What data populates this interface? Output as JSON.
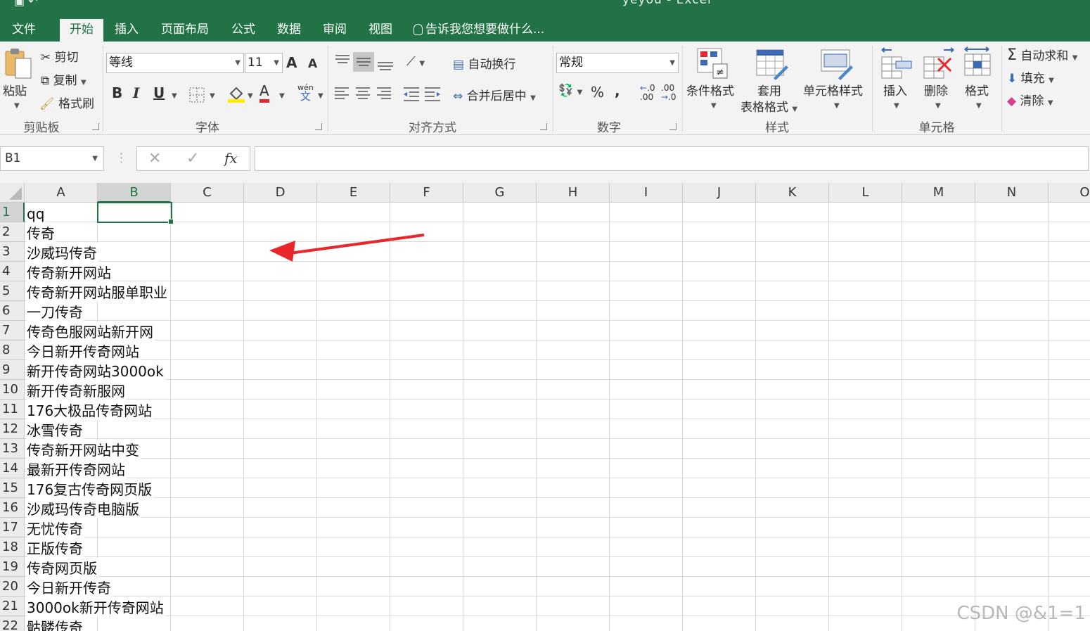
{
  "window": {
    "title": "yeyou - Excel"
  },
  "tabs": [
    {
      "label": "文件"
    },
    {
      "label": "开始",
      "active": true
    },
    {
      "label": "插入"
    },
    {
      "label": "页面布局"
    },
    {
      "label": "公式"
    },
    {
      "label": "数据"
    },
    {
      "label": "审阅"
    },
    {
      "label": "视图"
    }
  ],
  "tell_me": "告诉我您想要做什么...",
  "ribbon": {
    "clipboard": {
      "paste": "粘贴",
      "cut": "剪切",
      "copy": "复制",
      "format_painter": "格式刷",
      "group": "剪贴板"
    },
    "font": {
      "name": "等线",
      "size": "11",
      "bold": "B",
      "italic": "I",
      "underline": "U",
      "grow": "A",
      "shrink": "A",
      "font_color": "A",
      "phonetic": "wén",
      "phonetic2": "文",
      "group": "字体"
    },
    "alignment": {
      "wrap": "自动换行",
      "merge": "合并后居中",
      "group": "对齐方式"
    },
    "number": {
      "format": "常规",
      "percent": "%",
      "comma": ",",
      "inc_decimal": ".00",
      "dec_decimal": ".0",
      "group": "数字"
    },
    "styles": {
      "conditional": "条件格式",
      "table_1": "套用",
      "table_2": "表格格式",
      "cell_styles": "单元格样式",
      "group": "样式"
    },
    "cells": {
      "insert": "插入",
      "delete": "删除",
      "format": "格式",
      "group": "单元格"
    },
    "editing": {
      "autosum": "自动求和",
      "fill": "填充",
      "clear": "清除"
    }
  },
  "formula_bar": {
    "name_box": "B1",
    "cancel": "✕",
    "enter": "✓",
    "fx": "fx",
    "value": ""
  },
  "columns": [
    "A",
    "B",
    "C",
    "D",
    "E",
    "F",
    "G",
    "H",
    "I",
    "J",
    "K",
    "L",
    "M",
    "N",
    "O"
  ],
  "selected_cell": "B1",
  "rows": [
    {
      "n": "1",
      "a": "qq"
    },
    {
      "n": "2",
      "a": "传奇"
    },
    {
      "n": "3",
      "a": "沙威玛传奇"
    },
    {
      "n": "4",
      "a": "传奇新开网站"
    },
    {
      "n": "5",
      "a": "传奇新开网站服单职业"
    },
    {
      "n": "6",
      "a": "一刀传奇"
    },
    {
      "n": "7",
      "a": "传奇色服网站新开网"
    },
    {
      "n": "8",
      "a": "今日新开传奇网站"
    },
    {
      "n": "9",
      "a": "新开传奇网站3000ok"
    },
    {
      "n": "10",
      "a": "新开传奇新服网"
    },
    {
      "n": "11",
      "a": "176大极品传奇网站"
    },
    {
      "n": "12",
      "a": "冰雪传奇"
    },
    {
      "n": "13",
      "a": "传奇新开网站中变"
    },
    {
      "n": "14",
      "a": "最新开传奇网站"
    },
    {
      "n": "15",
      "a": "176复古传奇网页版"
    },
    {
      "n": "16",
      "a": "沙威玛传奇电脑版"
    },
    {
      "n": "17",
      "a": "无忧传奇"
    },
    {
      "n": "18",
      "a": "正版传奇"
    },
    {
      "n": "19",
      "a": "传奇网页版"
    },
    {
      "n": "20",
      "a": "今日新开传奇"
    },
    {
      "n": "21",
      "a": "3000ok新开传奇网站"
    },
    {
      "n": "22",
      "a": "骷髅传奇"
    }
  ],
  "watermark": "CSDN @&1=1",
  "colors": {
    "accent": "#217346",
    "annotation_arrow": "#e8262b"
  }
}
